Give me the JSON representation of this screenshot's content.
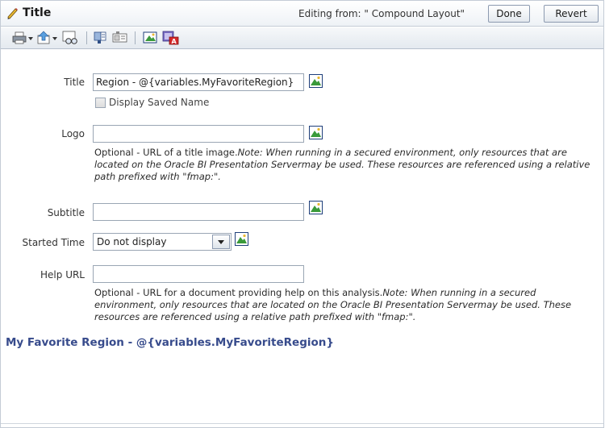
{
  "header": {
    "title": "Title",
    "editing_from": "Editing from: \" Compound Layout\"",
    "done_label": "Done",
    "revert_label": "Revert"
  },
  "toolbar": {
    "icons": [
      "print-icon",
      "export-icon",
      "preview-icon",
      "format-icon",
      "properties-icon",
      "image-icon",
      "clear-format-icon"
    ]
  },
  "form": {
    "title_label": "Title",
    "title_value": "Region - @{variables.MyFavoriteRegion}",
    "display_saved_name_label": "Display Saved Name",
    "logo_label": "Logo",
    "logo_value": "",
    "logo_help": "Optional - URL of a title image.",
    "logo_note": "Note: When running in a secured environment, only resources that are located on the Oracle BI Presentation Servermay be used. These resources are referenced using a relative path prefixed with \"fmap:\".",
    "subtitle_label": "Subtitle",
    "subtitle_value": "",
    "started_time_label": "Started Time",
    "started_time_value": "Do not display",
    "help_url_label": "Help URL",
    "help_url_value": "",
    "help_url_help": "Optional - URL for a document providing help on this analysis.",
    "help_url_note": "Note: When running in a secured environment, only resources that are located on the Oracle BI Presentation Servermay be used. These resources are referenced using a relative path prefixed with \"fmap:\"."
  },
  "preview": {
    "text": "My Favorite Region - @{variables.MyFavoriteRegion}"
  }
}
